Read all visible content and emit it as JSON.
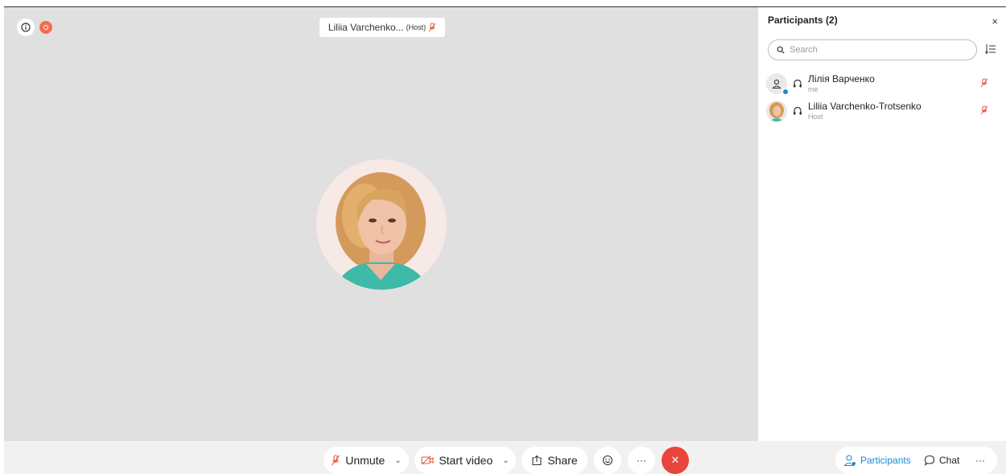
{
  "stage": {
    "active_speaker_name": "Liliia Varchenko...",
    "active_speaker_role": "(Host)"
  },
  "panel": {
    "title": "Participants (2)",
    "close_glyph": "×",
    "search_placeholder": "Search",
    "participants": [
      {
        "name": "Лілія Варченко",
        "sub": "me",
        "avatar": "person-icon",
        "muted": true
      },
      {
        "name": "Liliia Varchenko-Trotsenko",
        "sub": "Host",
        "avatar": "photo",
        "muted": true
      }
    ]
  },
  "toolbar": {
    "unmute_label": "Unmute",
    "start_video_label": "Start video",
    "share_label": "Share",
    "more_glyph": "···",
    "leave_glyph": "✕",
    "participants_label": "Participants",
    "chat_label": "Chat",
    "right_more_glyph": "···"
  },
  "colors": {
    "accent": "#1a8ad4",
    "danger": "#e8453c",
    "muted_icon": "#e8553e",
    "stage_bg": "#e0e0e0"
  }
}
